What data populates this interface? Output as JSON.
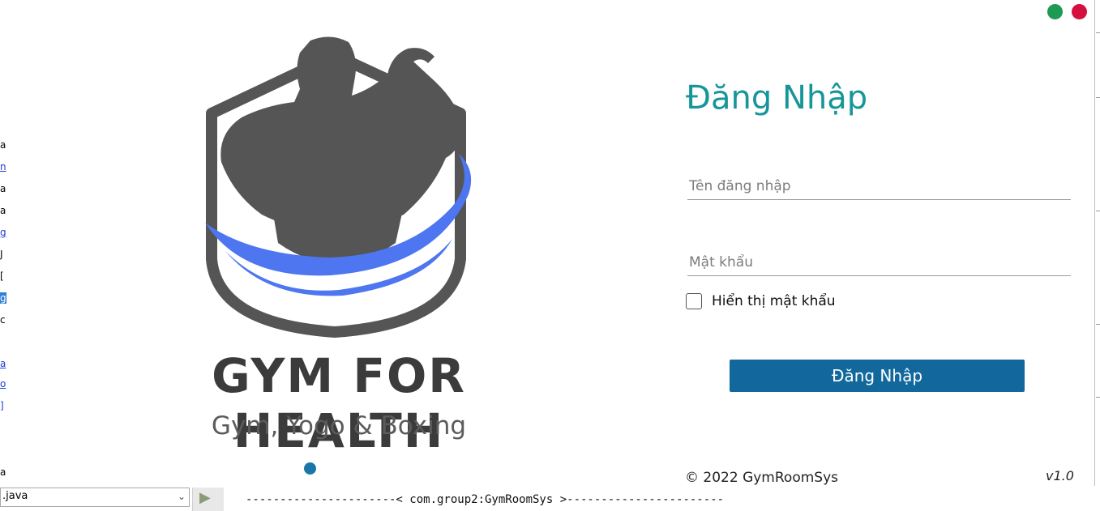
{
  "window": {
    "colors": {
      "accent": "#17969a",
      "button": "#12689c",
      "logo_ring": "#4d76f0",
      "logo_figure": "#555555"
    }
  },
  "brand": {
    "title": "GYM FOR HEALTH",
    "subtitle": "Gym, Yogo & Boxing"
  },
  "login": {
    "title": "Đăng Nhập",
    "username_placeholder": "Tên đăng nhập",
    "password_placeholder": "Mật khẩu",
    "show_password_label": "Hiển thị mật khẩu",
    "show_password_checked": false,
    "submit_label": "Đăng Nhập"
  },
  "footer": {
    "copyright": "© 2022 GymRoomSys",
    "version": "v1.0"
  },
  "ide": {
    "left_chars": [
      {
        "text": "a",
        "style": "plain"
      },
      {
        "text": "n",
        "style": "link"
      },
      {
        "text": "a",
        "style": "plain"
      },
      {
        "text": "a",
        "style": "plain"
      },
      {
        "text": "g",
        "style": "link"
      },
      {
        "text": "J",
        "style": "plain"
      },
      {
        "text": "[",
        "style": "plain"
      },
      {
        "text": "g",
        "style": "sel"
      },
      {
        "text": "c",
        "style": "plain"
      },
      {
        "text": "a",
        "style": "link"
      },
      {
        "text": "o",
        "style": "link"
      },
      {
        "text": "]",
        "style": "link"
      },
      {
        "text": "a",
        "style": "plain"
      }
    ],
    "file_combo_value": ".java",
    "console_line": "----------------------< com.group2:GymRoomSys >-----------------------"
  }
}
